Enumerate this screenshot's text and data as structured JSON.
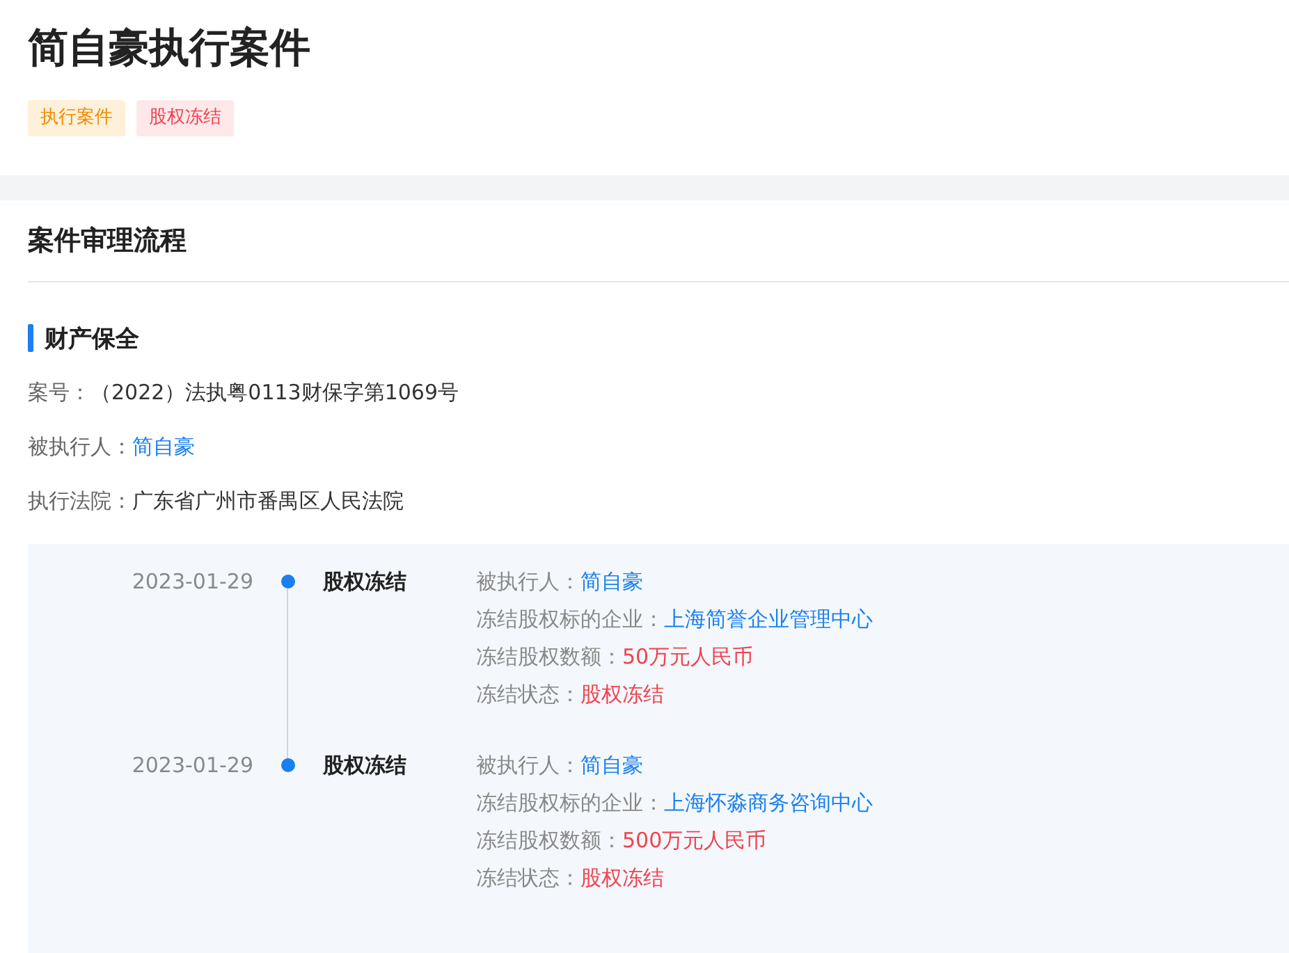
{
  "title": "简自豪执行案件",
  "tags": [
    {
      "label": "执行案件",
      "kind": "execution"
    },
    {
      "label": "股权冻结",
      "kind": "freeze"
    }
  ],
  "section": {
    "title": "案件审理流程"
  },
  "subsection": {
    "title": "财产保全",
    "fields": [
      {
        "label": "案号：",
        "value": "（2022）法执粤0113财保字第1069号",
        "kind": "plain"
      },
      {
        "label": "被执行人：",
        "value": "简自豪",
        "kind": "link"
      },
      {
        "label": "执行法院：",
        "value": "广东省广州市番禺区人民法院",
        "kind": "plain"
      }
    ]
  },
  "timeline": [
    {
      "date": "2023-01-29",
      "event": "股权冻结",
      "details": [
        {
          "label": "被执行人：",
          "value": "简自豪",
          "kind": "link"
        },
        {
          "label": "冻结股权标的企业：",
          "value": "上海简誉企业管理中心",
          "kind": "link"
        },
        {
          "label": "冻结股权数额：",
          "value": "50万元人民币",
          "kind": "alert"
        },
        {
          "label": "冻结状态：",
          "value": "股权冻结",
          "kind": "alert"
        }
      ]
    },
    {
      "date": "2023-01-29",
      "event": "股权冻结",
      "details": [
        {
          "label": "被执行人：",
          "value": "简自豪",
          "kind": "link"
        },
        {
          "label": "冻结股权标的企业：",
          "value": "上海怀淼商务咨询中心",
          "kind": "link"
        },
        {
          "label": "冻结股权数额：",
          "value": "500万元人民币",
          "kind": "alert"
        },
        {
          "label": "冻结状态：",
          "value": "股权冻结",
          "kind": "alert"
        }
      ]
    }
  ]
}
